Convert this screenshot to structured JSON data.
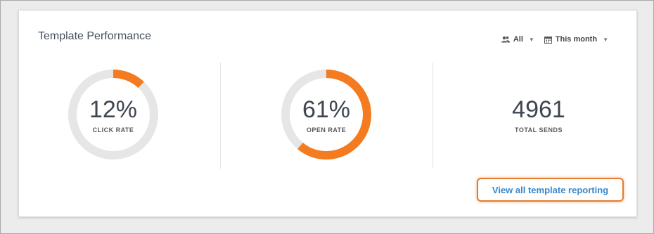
{
  "card": {
    "title": "Template Performance"
  },
  "filters": {
    "audience": {
      "label": "All",
      "icon": "users-icon"
    },
    "date_range": {
      "label": "This month",
      "icon": "calendar-icon"
    }
  },
  "metrics": [
    {
      "value": "12%",
      "label": "CLICK RATE",
      "fraction": 0.12
    },
    {
      "value": "61%",
      "label": "OPEN RATE",
      "fraction": 0.61
    },
    {
      "value": "4961",
      "label": "TOTAL SENDS"
    }
  ],
  "colors": {
    "accent": "#f47b20",
    "ring_track": "#e6e6e6",
    "link": "#3a87c8"
  },
  "link": {
    "label": "View all template reporting"
  }
}
